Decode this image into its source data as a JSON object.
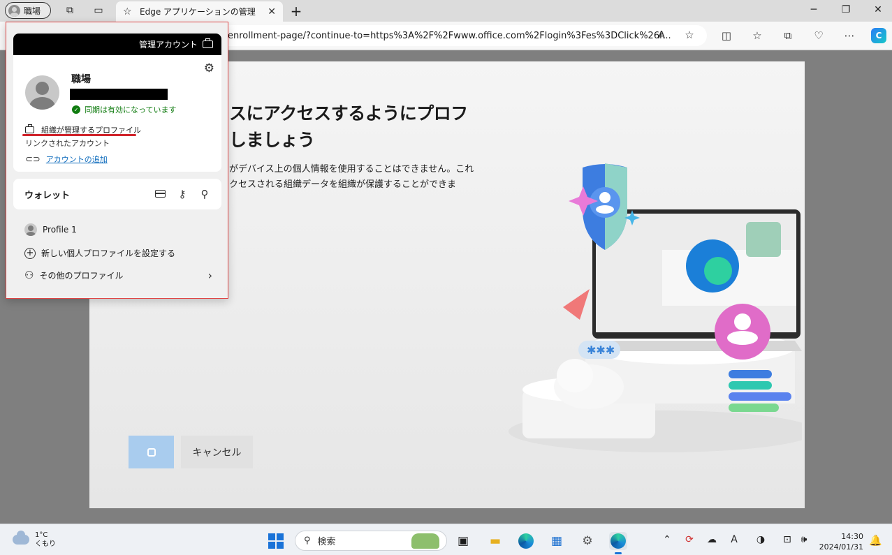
{
  "browser": {
    "profile_label": "職場",
    "tab_title": "Edge アプリケーションの管理",
    "address_visible": "enrollment-page/?continue-to=https%3A%2F%2Fwww.office.com%2Flogin%3Fes%3DClick%26r...",
    "read_aloud_label": "A",
    "copilot_label": "C"
  },
  "dialog": {
    "heading_line1": "スにアクセスするようにプロフ",
    "heading_line2": "しましょう",
    "desc_line1": "がデバイス上の個人情報を使用することはできません。これ",
    "desc_line2": "クセスされる組織データを組織が保護することができま",
    "cancel_label": "キャンセル"
  },
  "flyout": {
    "header_label": "管理アカウント",
    "profile_name": "職場",
    "sync_status": "同期は有効になっています",
    "managed_label": "組織が管理するプロファイル",
    "linked_accounts": "リンクされたアカウント",
    "add_account": "アカウントの追加",
    "wallet_label": "ウォレット",
    "other_profile": "Profile 1",
    "new_profile": "新しい個人プロファイルを設定する",
    "more_profiles": "その他のプロファイル"
  },
  "taskbar": {
    "temperature": "1°C",
    "weather": "くもり",
    "search_placeholder": "検索",
    "time": "14:30",
    "date": "2024/01/31"
  },
  "colors": {
    "accent": "#1a73d8",
    "highlight_border": "#e04444",
    "sync_green": "#107c10"
  }
}
